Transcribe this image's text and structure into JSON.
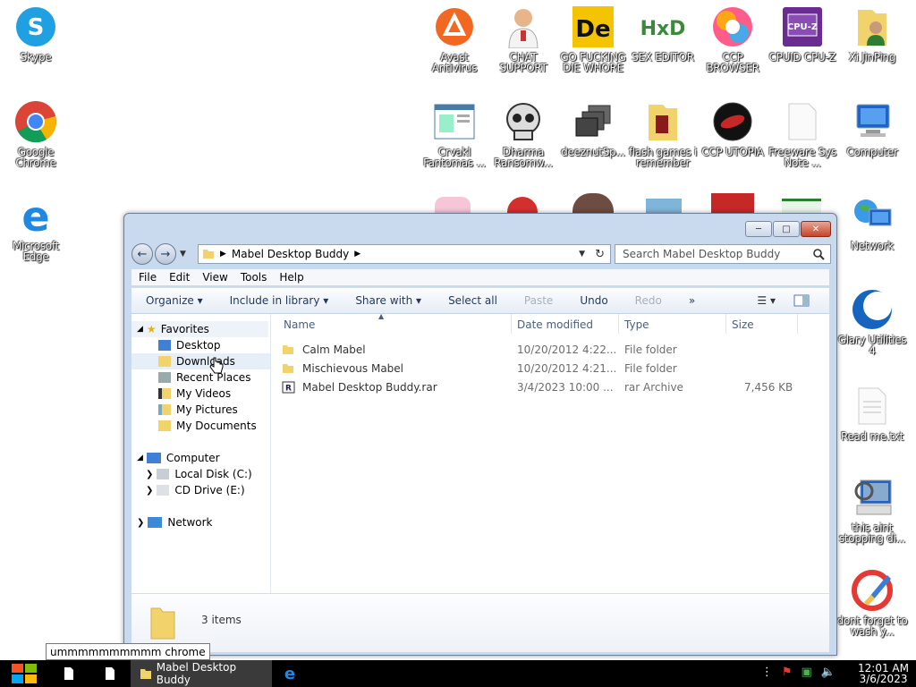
{
  "desktop": {
    "icons": [
      {
        "label": "Skype"
      },
      {
        "label": "Google Chrome"
      },
      {
        "label": "Microsoft Edge"
      },
      {
        "label": "Avast Antivirus"
      },
      {
        "label": "CHAT SUPPORT"
      },
      {
        "label": "GO FUCKING DIE WHORE"
      },
      {
        "label": "SEX EDITOR"
      },
      {
        "label": "CCP BROWSER"
      },
      {
        "label": "CPUID CPU-Z"
      },
      {
        "label": "Xi JinPing"
      },
      {
        "label": "Crvakl Fantomas ..."
      },
      {
        "label": "Dharma Ransomw..."
      },
      {
        "label": "deeznutSp..."
      },
      {
        "label": "flash games i remember"
      },
      {
        "label": "CCP UTOPIA"
      },
      {
        "label": "Freeware Sys Note ..."
      },
      {
        "label": "Computer"
      },
      {
        "label": "Network"
      },
      {
        "label": "Glary Utilities 4"
      },
      {
        "label": "Read me.txt"
      },
      {
        "label": "this aint stopping di..."
      },
      {
        "label": "dont forget to wash y..."
      }
    ]
  },
  "explorer": {
    "breadcrumb": "Mabel Desktop Buddy",
    "search_placeholder": "Search Mabel Desktop Buddy",
    "menu": [
      "File",
      "Edit",
      "View",
      "Tools",
      "Help"
    ],
    "commands": [
      {
        "label": "Organize ▾",
        "disabled": false
      },
      {
        "label": "Include in library ▾",
        "disabled": false
      },
      {
        "label": "Share with ▾",
        "disabled": false
      },
      {
        "label": "Select all",
        "disabled": false
      },
      {
        "label": "Paste",
        "disabled": true
      },
      {
        "label": "Undo",
        "disabled": false
      },
      {
        "label": "Redo",
        "disabled": true
      },
      {
        "label": "»",
        "disabled": false
      }
    ],
    "nav": {
      "favorites": "Favorites",
      "fav_items": [
        "Desktop",
        "Downloads",
        "Recent Places",
        "My Videos",
        "My Pictures",
        "My Documents"
      ],
      "computer": "Computer",
      "drives": [
        "Local Disk (C:)",
        "CD Drive (E:)"
      ],
      "network": "Network"
    },
    "columns": [
      "Name",
      "Date modified",
      "Type",
      "Size"
    ],
    "files": [
      {
        "name": "Calm Mabel",
        "date": "10/20/2012 4:22...",
        "type": "File folder",
        "size": ""
      },
      {
        "name": "Mischievous Mabel",
        "date": "10/20/2012 4:21...",
        "type": "File folder",
        "size": ""
      },
      {
        "name": "Mabel Desktop Buddy.rar",
        "date": "3/4/2023 10:00 ...",
        "type": "rar Archive",
        "size": "7,456 KB"
      }
    ],
    "status": "3 items"
  },
  "tooltip": "ummmmmmmmmm chrome",
  "taskbar": {
    "active_window": "Mabel Desktop Buddy",
    "time": "12:01 AM",
    "date": "3/6/2023"
  }
}
